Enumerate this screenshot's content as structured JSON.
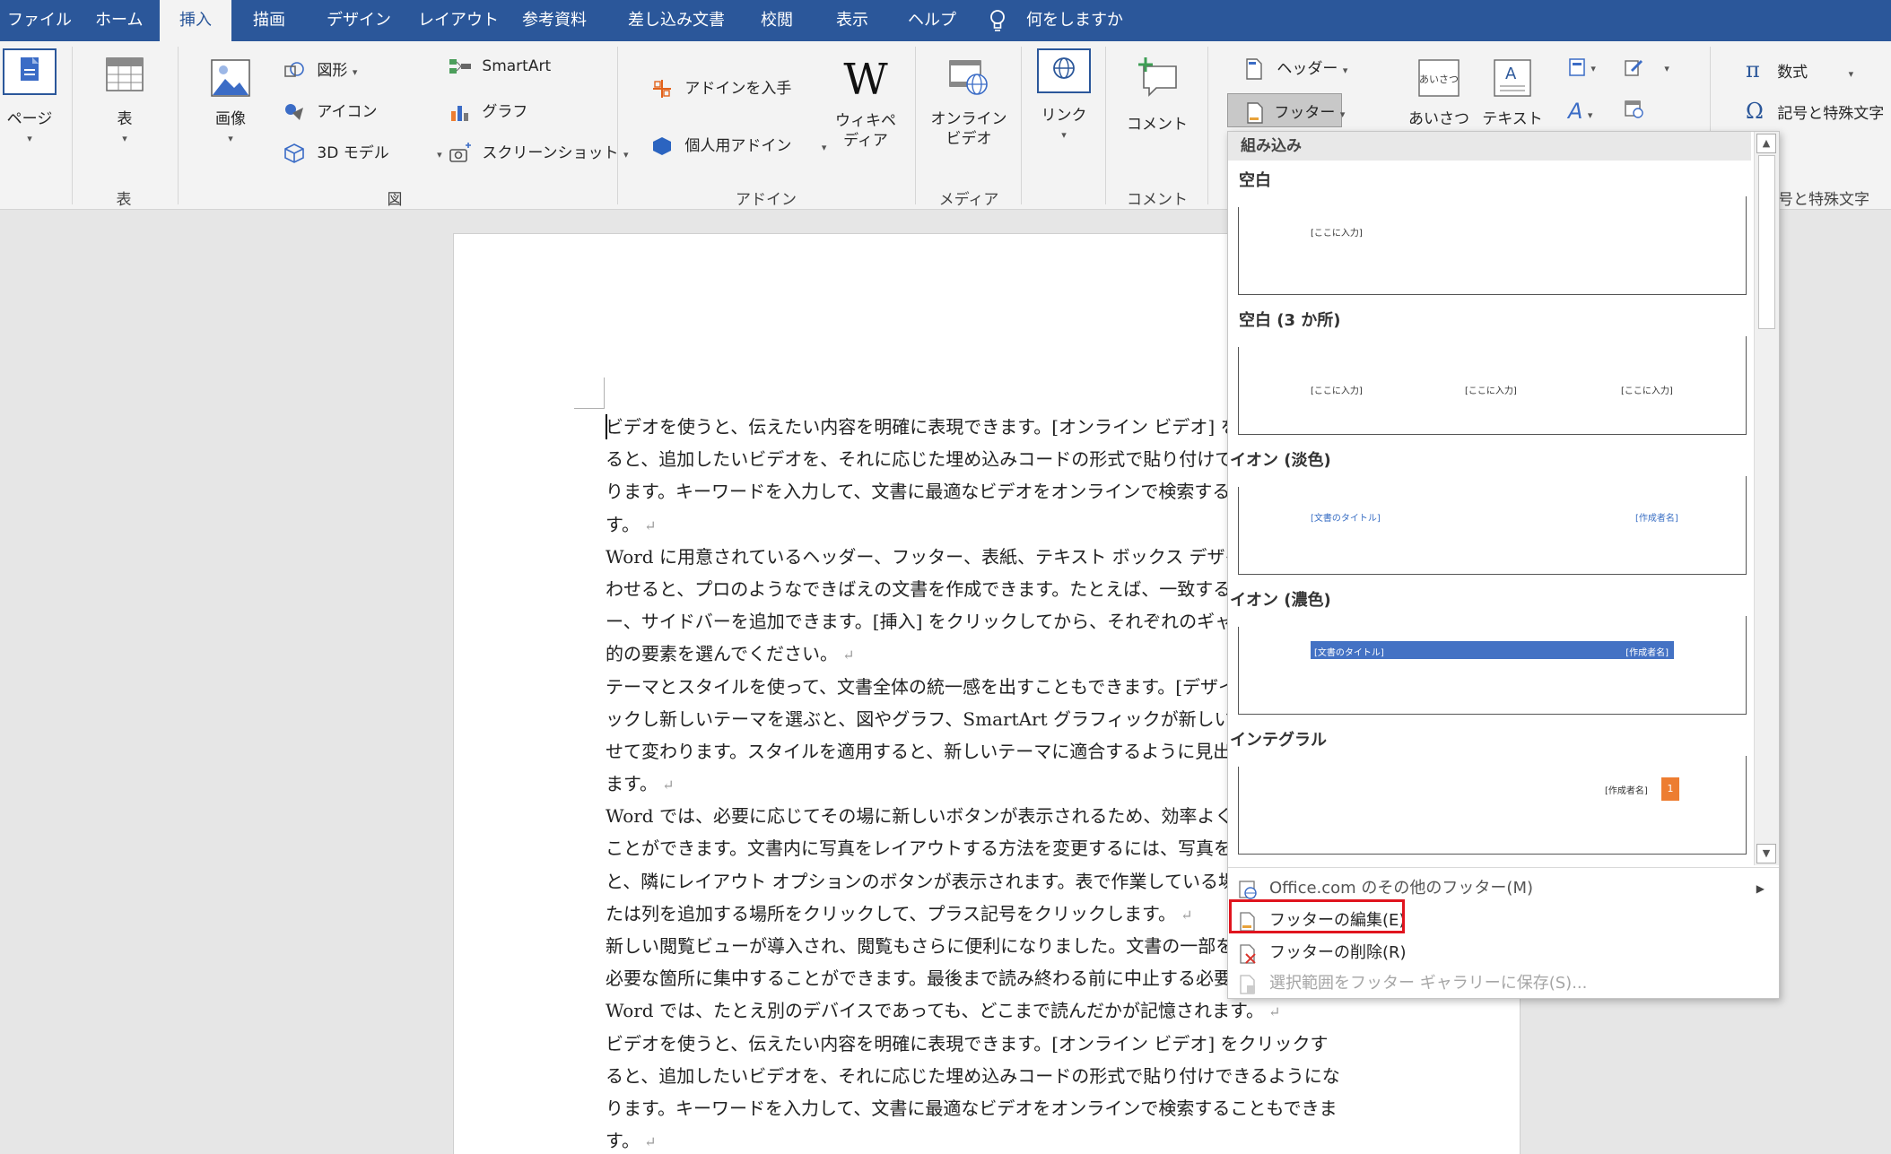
{
  "tabs": [
    "ファイル",
    "ホーム",
    "挿入",
    "描画",
    "デザイン",
    "レイアウト",
    "参考資料",
    "差し込み文書",
    "校閲",
    "表示",
    "ヘルプ"
  ],
  "tell_me": "何をしますか",
  "ribbon": {
    "pages_label": "ページ",
    "table": {
      "button": "表",
      "group": "表"
    },
    "illustrations": {
      "image": "画像",
      "shapes": "図形",
      "icons": "アイコン",
      "model3d": "3D モデル",
      "smartart": "SmartArt",
      "chart": "グラフ",
      "screenshot": "スクリーンショット",
      "group": "図"
    },
    "addins": {
      "get": "アドインを入手",
      "my": "個人用アドイン",
      "wiki_line1": "ウィキペ",
      "wiki_line2": "ディア",
      "group": "アドイン"
    },
    "media": {
      "line1": "オンライン",
      "line2": "ビデオ",
      "group": "メディア"
    },
    "link": "リンク",
    "comment": {
      "button": "コメント",
      "group": "コメント"
    },
    "header": "ヘッダー",
    "footer": "フッター",
    "greeting": "あいさつ",
    "text": "テキスト",
    "equation": "数式",
    "symbol": "記号と特殊文字",
    "symbol_group": "号と特殊文字"
  },
  "document": {
    "paragraphs": [
      "ビデオを使うと、伝えたい内容を明確に表現できます。[オンライン ビデオ] をクリックす",
      "ると、追加したいビデオを、それに応じた埋め込みコードの形式で貼り付けできるようにな",
      "ります。キーワードを入力して、文書に最適なビデオをオンラインで検索することもできま",
      "す。",
      "Word に用意されているヘッダー、フッター、表紙、テキスト ボックス デザインを組み合",
      "わせると、プロのようなできばえの文書を作成できます。たとえば、一致する表紙、ヘッダ",
      "ー、サイドバーを追加できます。[挿入] をクリックしてから、それぞれのギャラリーで目",
      "的の要素を選んでください。",
      "テーマとスタイルを使って、文書全体の統一感を出すこともできます。[デザイン] をクリ",
      "ックし新しいテーマを選ぶと、図やグラフ、SmartArt グラフィックが新しいテーマに合わ",
      "せて変わります。スタイルを適用すると、新しいテーマに適合するように見出しが変更され",
      "ます。",
      "Word では、必要に応じてその場に新しいボタンが表示されるため、効率よく操作を進める",
      "ことができます。文書内に写真をレイアウトする方法を変更するには、写真をクリックする",
      "と、隣にレイアウト オプションのボタンが表示されます。表で作業している場合は、行ま",
      "たは列を追加する場所をクリックして、プラス記号をクリックします。",
      "新しい閲覧ビューが導入され、閲覧もさらに便利になりました。文書の一部を折りたたんで、",
      "必要な箇所に集中することができます。最後まで読み終わる前に中止する必要がある場合、",
      "Word では、たとえ別のデバイスであっても、どこまで読んだかが記憶されます。",
      "ビデオを使うと、伝えたい内容を明確に表現できます。[オンライン ビデオ] をクリックす",
      "ると、追加したいビデオを、それに応じた埋め込みコードの形式で貼り付けできるようにな",
      "ります。キーワードを入力して、文書に最適なビデオをオンラインで検索することもできま",
      "す。"
    ],
    "paragraph_end_lines": [
      3,
      7,
      11,
      15,
      18,
      22
    ]
  },
  "footer_dropdown": {
    "section": "組み込み",
    "gallery": [
      {
        "title": "空白",
        "placeholders": [
          "[ここに入力]"
        ]
      },
      {
        "title": "空白 (3 か所)",
        "placeholders": [
          "[ここに入力]",
          "[ここに入力]",
          "[ここに入力]"
        ]
      },
      {
        "title": "イオン (淡色)",
        "placeholders": [
          "[文書のタイトル]",
          "[作成者名]"
        ]
      },
      {
        "title": "イオン (濃色)",
        "placeholders": [
          "[文書のタイトル]",
          "[作成者名]"
        ]
      },
      {
        "title": "インテグラル",
        "placeholders": [
          "[作成者名]",
          "1"
        ]
      }
    ],
    "menu": {
      "more": "Office.com のその他のフッター(M)",
      "edit": "フッターの編集(E)",
      "remove": "フッターの削除(R)",
      "save": "選択範囲をフッター ギャラリーに保存(S)..."
    }
  },
  "colors": {
    "accent": "#2b579a",
    "highlight": "#e0141e",
    "ion_dark_bar": "#4472c4",
    "integral_orange": "#ed7d31"
  }
}
